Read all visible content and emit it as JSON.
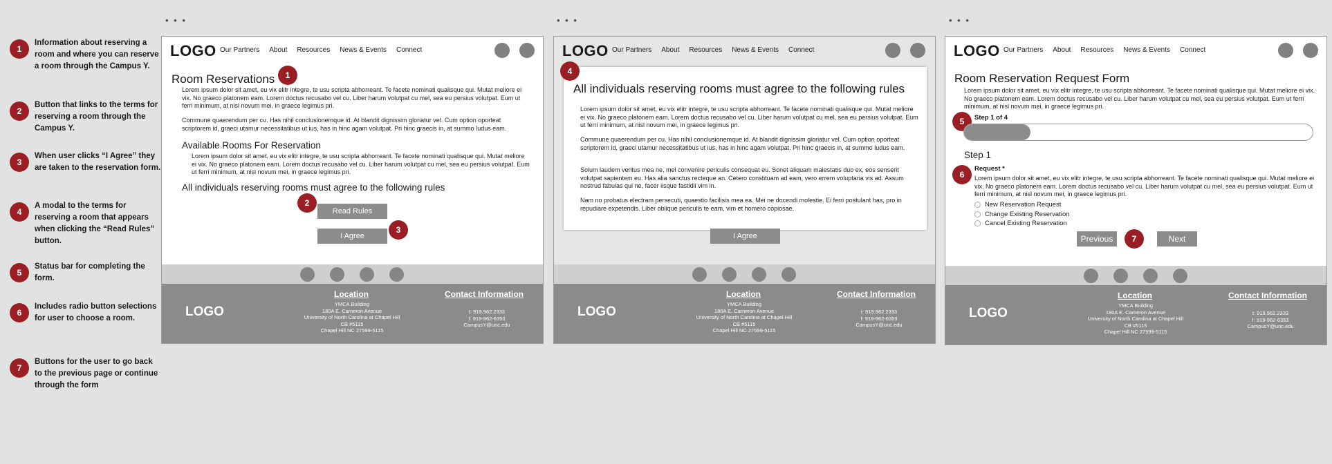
{
  "legend": [
    {
      "num": "1",
      "text": "Information about reserving a room and where you can reserve a room through the Campus Y."
    },
    {
      "num": "2",
      "text": "Button that links to the terms for reserving a room through the Campus Y."
    },
    {
      "num": "3",
      "text": "When user clicks “I Agree” they are taken to the reservation form."
    },
    {
      "num": "4",
      "text": "A modal to the terms for reserving a room that appears when clicking the “Read Rules” button."
    },
    {
      "num": "5",
      "text": "Status bar for completing the form."
    },
    {
      "num": "6",
      "text": "Includes radio button selections for user to choose a room."
    },
    {
      "num": "7",
      "text": "Buttons for the user to go back to the previous page or continue through the form"
    }
  ],
  "dots": "• • •",
  "nav": {
    "logo": "LOGO",
    "links": [
      "Our Partners",
      "About",
      "Resources",
      "News & Events",
      "Connect"
    ]
  },
  "footer": {
    "logo": "LOGO",
    "location_title": "Location",
    "location_lines": [
      "YMCA Building",
      "180A E. Cameron Avenue",
      "University of North Carolina at Chapel Hill",
      "CB #5115",
      "Chapel Hill NC 27599-5115"
    ],
    "contact_title": "Contact Information",
    "contact_lines": [
      "t: 919.962.2333",
      "f: 919-962-6353",
      "CampusY@unc.edu"
    ]
  },
  "frame1": {
    "title": "Room Reservations",
    "p1": "Lorem ipsum dolor sit amet, eu vix elitr integre, te usu scripta abhorreant. Te facete nominati qualisque qui. Mutat meliore ei vix. No graeco platonem eam. Lorem doctus recusabo vel cu. Liber harum volutpat cu mel, sea eu persius volutpat. Eum ut ferri minimum, at nisl novum mei, in graece legimus pri.",
    "p2": "Commune quaerendum per cu. Has nihil conclusionemque id. At blandit dignissim gloriatur vel. Cum option oporteat scriptorem id, graeci utamur necessitatibus ut ius, has in hinc agam volutpat. Pri hinc graecis in, at summo ludus eam.",
    "subtitle": "Available Rooms For Reservation",
    "p3": "Lorem ipsum dolor sit amet, eu vix elitr integre, te usu scripta abhorreant. Te facete nominati qualisque qui. Mutat meliore ei vix. No graeco platonem eam. Lorem doctus recusabo vel cu. Liber harum volutpat cu mel, sea eu persius volutpat. Eum ut ferri minimum, at nisl novum mei, in graece legimus pri.",
    "rules_heading": "All individuals reserving rooms must agree to the following rules",
    "read_rules": "Read Rules",
    "agree": "I Agree"
  },
  "frame2": {
    "modal_title": "All individuals reserving rooms must agree to the following rules",
    "p1": "Lorem ipsum dolor sit amet, eu vix elitr integre, te usu scripta abhorreant. Te facete nominati qualisque qui. Mutat meliore ei vix. No graeco platonem eam. Lorem doctus recusabo vel cu. Liber harum volutpat cu mel, sea eu persius volutpat. Eum ut ferri minimum, at nisl novum mei, in graece legimus pri.",
    "p2": "Commune quaerendum per cu. Has nihil conclusionemque id. At blandit dignissim gloriatur vel. Cum option oporteat scriptorem id, graeci utamur necessitatibus ut ius, has in hinc agam volutpat. Pri hinc graecis in, at summo ludus eam.",
    "p3": "Solum laudem veritus mea ne, mel convenire periculis consequat eu. Sonet aliquam maiestatis duo ex, eos senserit volutpat sapientem eu. Has alia sanctus recteque an. Cetero constituam ad eam, vero errem voluptaria vis ad. Assum nostrud fabulas qui ne, facer iisque fastidii vim in.",
    "p4": "Nam no probatus electram persecuti, quaestio facilisis mea ea. Mei ne docendi molestie. Ei ferri postulant has, pro in repudiare expetendis. Liber oblique periculis te eam, vim et homero copiosae.",
    "agree": "I Agree"
  },
  "frame3": {
    "title": "Room Reservation Request Form",
    "p1": "Lorem ipsum dolor sit amet, eu vix elitr integre, te usu scripta abhorreant. Te facete nominati qualisque qui. Mutat meliore ei vix. No graeco platonem eam. Lorem doctus recusabo vel cu. Liber harum volutpat cu mel, sea eu persius volutpat. Eum ut ferri minimum, at nisl novum mei, in graece legimus pri.",
    "step_label": "Step 1 of 4",
    "progress": 0.19,
    "step_heading": "Step 1",
    "request_label": "Request *",
    "p2": "Lorem ipsum dolor sit amet, eu vix elitr integre, te usu scripta abhorreant. Te facete nominati qualisque qui. Mutat meliore ei vix. No graeco platonem eam. Lorem doctus recusabo vel cu. Liber harum volutpat cu mel, sea eu persius volutpat. Eum ut ferri minimum, at nisl novum mei, in graece legimus pri.",
    "options": [
      "New Reservation Request",
      "Change Existing Reservation",
      "Cancel Existing Reservation"
    ],
    "previous": "Previous",
    "next": "Next"
  },
  "badges": {
    "b1": "1",
    "b2": "2",
    "b3": "3",
    "b4": "4",
    "b5": "5",
    "b6": "6",
    "b7": "7"
  },
  "colors": {
    "badge": "#9a1f24",
    "button": "#8c8c8c",
    "footer": "#8b8b8b"
  }
}
